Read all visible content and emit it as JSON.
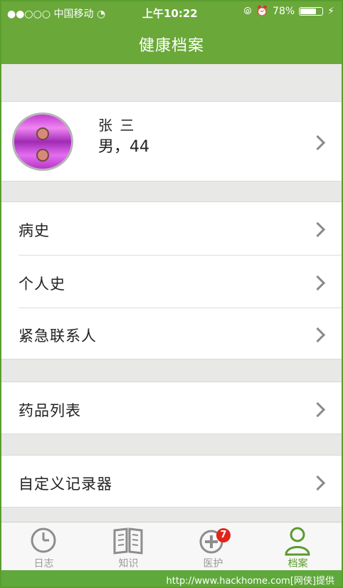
{
  "status_bar": {
    "carrier": "●●○○○ 中国移动",
    "time": "上午10:22",
    "battery": "78%",
    "battery_level": 0.78
  },
  "header": {
    "title": "健康档案"
  },
  "profile": {
    "name": "张 三",
    "info": "男，44"
  },
  "menu_groups": [
    {
      "items": [
        {
          "label": "病史"
        },
        {
          "label": "个人史"
        },
        {
          "label": "紧急联系人"
        }
      ]
    },
    {
      "items": [
        {
          "label": "药品列表"
        }
      ]
    },
    {
      "items": [
        {
          "label": "自定义记录器"
        }
      ]
    }
  ],
  "tab_bar": {
    "tabs": [
      {
        "label": "日志",
        "icon": "clock-icon"
      },
      {
        "label": "知识",
        "icon": "book-icon"
      },
      {
        "label": "医护",
        "icon": "medical-plus-icon",
        "badge": "7"
      },
      {
        "label": "档案",
        "icon": "person-icon",
        "active": true
      }
    ]
  },
  "footer": {
    "watermark": "http://www.hackhome.com[网侠]提供"
  },
  "colors": {
    "primary": "#6aa83a",
    "badge": "#e2231a",
    "active_tab": "#5c9a2e"
  }
}
